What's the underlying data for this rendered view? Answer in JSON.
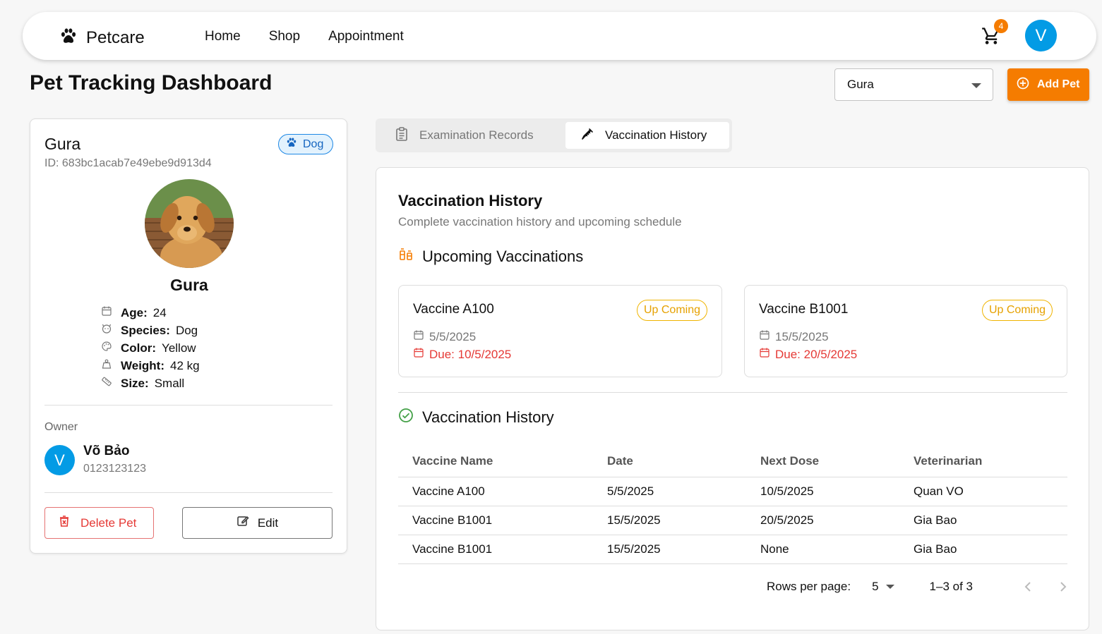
{
  "header": {
    "brand": "Petcare",
    "nav": [
      "Home",
      "Shop",
      "Appointment"
    ],
    "cart_count": "4",
    "user_initial": "V"
  },
  "page": {
    "title": "Pet Tracking Dashboard",
    "selected_pet": "Gura",
    "add_pet_label": "Add Pet"
  },
  "pet": {
    "name": "Gura",
    "id_text": "ID: 683bc1acab7e49ebe9d913d4",
    "species_chip": "Dog",
    "details": [
      {
        "label": "Age:",
        "value": "24",
        "icon": "calendar-icon"
      },
      {
        "label": "Species:",
        "value": "Dog",
        "icon": "pet-face-icon"
      },
      {
        "label": "Color:",
        "value": "Yellow",
        "icon": "palette-icon"
      },
      {
        "label": "Weight:",
        "value": "42 kg",
        "icon": "weight-icon"
      },
      {
        "label": "Size:",
        "value": "Small",
        "icon": "ruler-icon"
      }
    ],
    "owner_label": "Owner",
    "owner_initial": "V",
    "owner_name": "Võ Bảo",
    "owner_phone": "0123123123",
    "delete_label": "Delete Pet",
    "edit_label": "Edit"
  },
  "tabs": {
    "exam": "Examination Records",
    "vacc": "Vaccination History"
  },
  "panel": {
    "title": "Vaccination History",
    "subtitle": "Complete vaccination history and upcoming schedule",
    "upcoming_title": "Upcoming Vaccinations",
    "history_title": "Vaccination History",
    "upcoming": [
      {
        "name": "Vaccine A100",
        "status": "Up Coming",
        "date": "5/5/2025",
        "due": "Due: 10/5/2025"
      },
      {
        "name": "Vaccine B1001",
        "status": "Up Coming",
        "date": "15/5/2025",
        "due": "Due: 20/5/2025"
      }
    ],
    "table": {
      "headers": [
        "Vaccine Name",
        "Date",
        "Next Dose",
        "Veterinarian"
      ],
      "rows": [
        [
          "Vaccine A100",
          "5/5/2025",
          "10/5/2025",
          "Quan VO"
        ],
        [
          "Vaccine B1001",
          "15/5/2025",
          "20/5/2025",
          "Gia Bao"
        ],
        [
          "Vaccine B1001",
          "15/5/2025",
          "None",
          "Gia Bao"
        ]
      ]
    },
    "pagination": {
      "rows_label": "Rows per page:",
      "rows_value": "5",
      "range": "1–3 of 3"
    }
  },
  "colors": {
    "accent": "#f57c00",
    "avatar": "#039be5",
    "danger": "#e53935",
    "chip_blue": "#1565c0",
    "upcoming": "#e6a100",
    "success": "#43a047"
  }
}
